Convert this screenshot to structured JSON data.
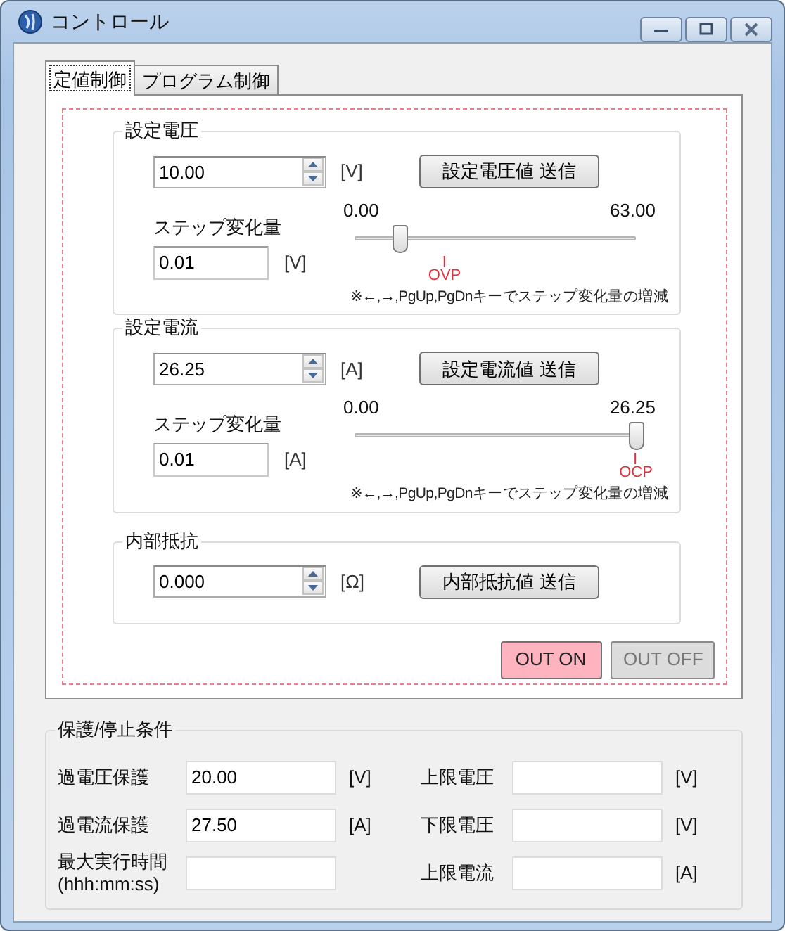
{
  "window": {
    "title": "コントロール"
  },
  "tabs": [
    {
      "label": "定値制御",
      "selected": true
    },
    {
      "label": "プログラム制御",
      "selected": false
    }
  ],
  "groups": [
    {
      "kind": "slider",
      "title": "設定電圧",
      "value": "10.00",
      "unit": "[V]",
      "button": "設定電圧値 送信",
      "step_label": "ステップ変化量",
      "step_value": "0.01",
      "step_unit": "[V]",
      "slider": {
        "min": "0.00",
        "max": "63.00",
        "level": 0.16
      },
      "marker": {
        "label": "OVP"
      },
      "hint": "※←,→,PgUp,PgDnキーでステップ変化量の増減"
    },
    {
      "kind": "slider",
      "title": "設定電流",
      "value": "26.25",
      "unit": "[A]",
      "button": "設定電流値 送信",
      "step_label": "ステップ変化量",
      "step_value": "0.01",
      "step_unit": "[A]",
      "slider": {
        "min": "0.00",
        "max": "26.25",
        "level": 1.0
      },
      "marker": {
        "label": "OCP"
      },
      "hint": "※←,→,PgUp,PgDnキーでステップ変化量の増減"
    },
    {
      "kind": "simple",
      "title": "内部抵抗",
      "value": "0.000",
      "unit": "[Ω]",
      "button": "内部抵抗値 送信"
    }
  ],
  "output_buttons": [
    {
      "label": "OUT ON",
      "selected": true
    },
    {
      "label": "OUT OFF",
      "selected": false
    }
  ],
  "protection": {
    "title": "保護/停止条件",
    "left": [
      {
        "label": "過電圧保護",
        "value": "20.00",
        "unit": "[V]"
      },
      {
        "label": "過電流保護",
        "value": "27.50",
        "unit": "[A]"
      },
      {
        "label": "最大実行時間",
        "sublabel": "(hhh:mm:ss)"
      }
    ],
    "right": [
      {
        "label": "上限電圧",
        "unit": "[V]"
      },
      {
        "label": "下限電圧",
        "unit": "[V]"
      },
      {
        "label": "上限電流",
        "unit": "[A]"
      }
    ]
  }
}
